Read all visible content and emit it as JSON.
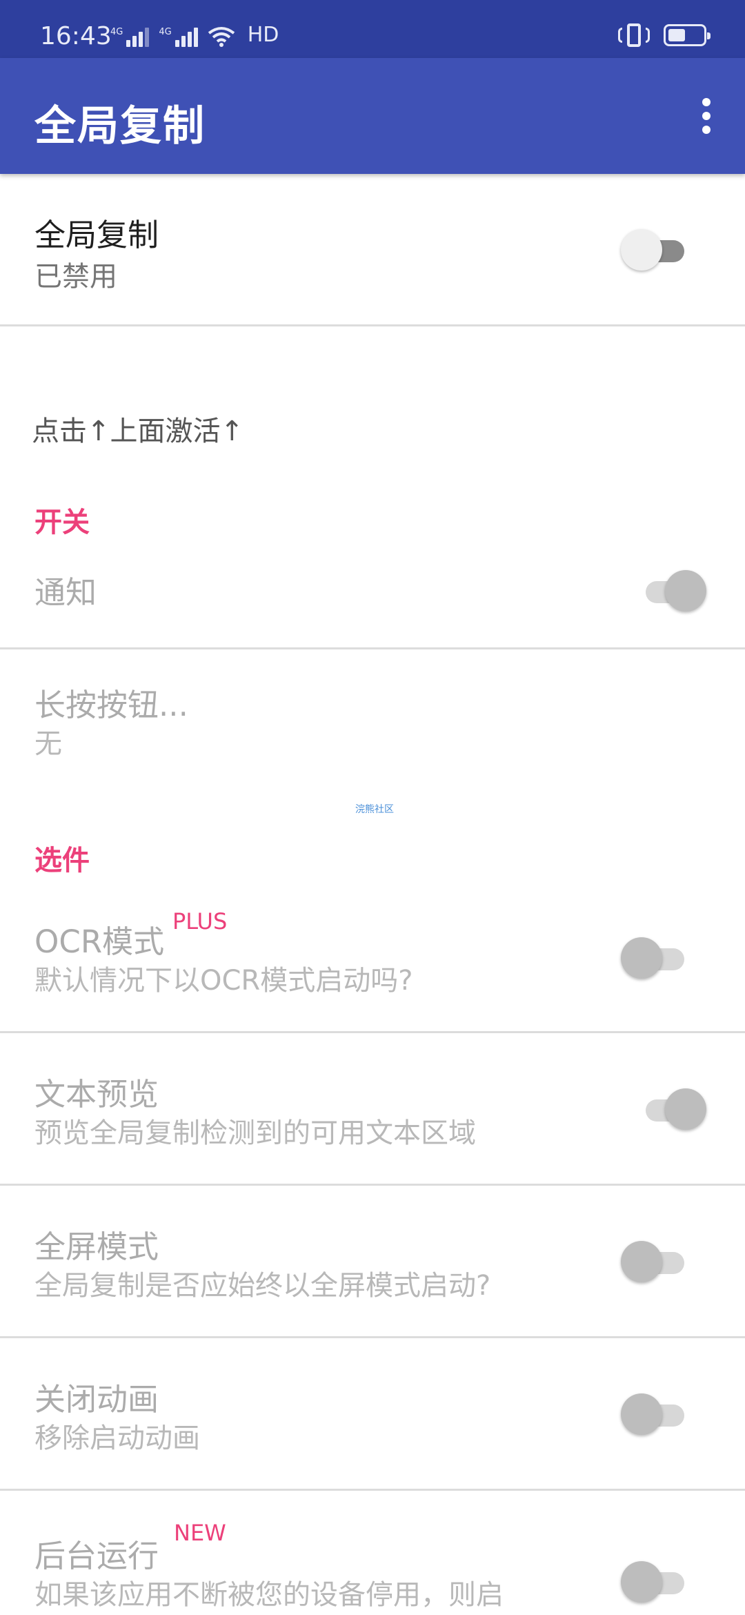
{
  "status_bar": {
    "time": "16:43",
    "sim1_tag": "4G",
    "sim2_tag": "4G",
    "hd_label": "HD"
  },
  "app_bar": {
    "title": "全局复制",
    "menu_icon": "more-vert-icon"
  },
  "master": {
    "title": "全局复制",
    "summary": "已禁用",
    "enabled": false
  },
  "hint_text": "点击↑上面激活↑",
  "sections": {
    "switches": {
      "header": "开关",
      "notification_title": "通知",
      "notification_on": true,
      "long_press_title": "长按按钮...",
      "long_press_value": "无"
    },
    "watermark": "浣熊社区",
    "options": {
      "header": "选件",
      "ocr_title": "OCR模式",
      "ocr_badge": "PLUS",
      "ocr_summary": "默认情况下以OCR模式启动吗?",
      "ocr_on": false,
      "preview_title": "文本预览",
      "preview_summary": "预览全局复制检测到的可用文本区域",
      "preview_on": true,
      "fullscreen_title": "全屏模式",
      "fullscreen_summary": "全局复制是否应始终以全屏模式启动?",
      "fullscreen_on": false,
      "anim_title": "关闭动画",
      "anim_summary": "移除启动动画",
      "anim_on": false,
      "bg_title": "后台运行",
      "bg_badge": "NEW",
      "bg_summary": "如果该应用不断被您的设备停用，则启",
      "bg_on": false
    }
  },
  "colors": {
    "status_bar": "#2e3f9e",
    "app_bar": "#3f51b5",
    "accent": "#ec407a"
  }
}
